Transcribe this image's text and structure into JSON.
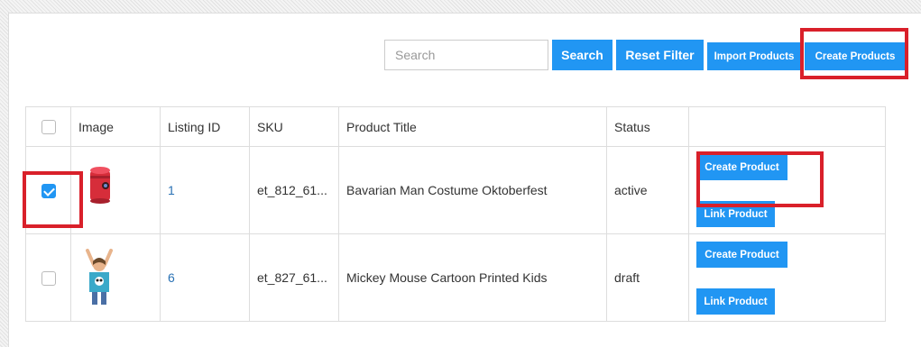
{
  "toolbar": {
    "search_placeholder": "Search",
    "search_label": "Search",
    "reset_label": "Reset Filter",
    "import_label": "Import Products",
    "create_all_label": "Create Products"
  },
  "table": {
    "headers": [
      "Image",
      "Listing ID",
      "SKU",
      "Product Title",
      "Status"
    ],
    "rows": [
      {
        "checked": true,
        "image": "red-mini-projector-icon",
        "listing_id": "1",
        "sku": "et_812_61...",
        "title": "Bavarian Man Costume Oktoberfest",
        "status": "active",
        "create_label": "Create Product",
        "link_label": "Link Product"
      },
      {
        "checked": false,
        "image": "kids-mickey-tshirt-icon",
        "listing_id": "6",
        "sku": "et_827_61...",
        "title": "Mickey Mouse Cartoon Printed Kids",
        "status": "draft",
        "create_label": "Create Product",
        "link_label": "Link Product"
      }
    ]
  },
  "colors": {
    "accent": "#2196f3",
    "highlight": "#d9202a"
  }
}
